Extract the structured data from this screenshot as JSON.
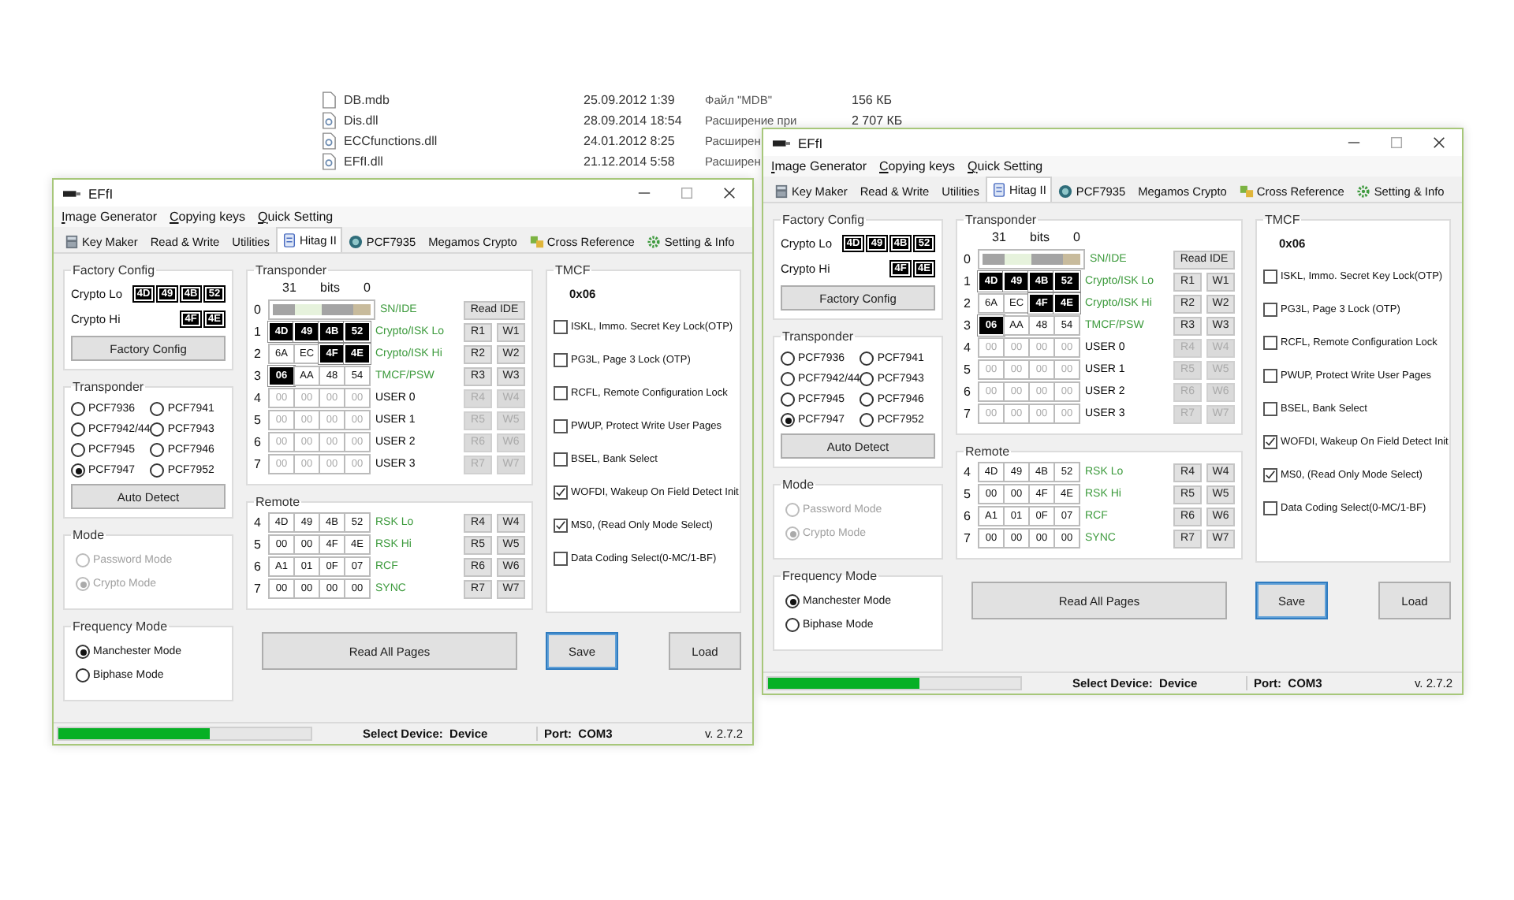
{
  "files": [
    {
      "kind": "document",
      "name": "DB.mdb",
      "date": "25.09.2012 1:39",
      "type": "Файл \"MDB\"",
      "size": "156 КБ"
    },
    {
      "kind": "library",
      "name": "Dis.dll",
      "date": "28.09.2014 18:54",
      "type": "Расширение при",
      "size": "2 707 КБ"
    },
    {
      "kind": "library",
      "name": "ECCfunctions.dll",
      "date": "24.01.2012 8:25",
      "type": "Расширен"
    },
    {
      "kind": "library",
      "name": "EFfI.dll",
      "date": "21.12.2014 5:58",
      "type": "Расширен"
    }
  ],
  "windows": [
    {
      "title": "EFfI",
      "menu": [
        "Image Generator",
        "Copying keys",
        "Quick Setting"
      ],
      "tabs": [
        {
          "label": "Key Maker",
          "kind": "calculator",
          "selected": false
        },
        {
          "label": "Read & Write",
          "kind": "text",
          "selected": false
        },
        {
          "label": "Utilities",
          "kind": "text",
          "selected": false
        },
        {
          "label": "Hitag II",
          "kind": "card",
          "selected": true
        },
        {
          "label": "PCF7935",
          "kind": "disc",
          "selected": false
        },
        {
          "label": "Megamos Crypto",
          "kind": "text",
          "selected": false
        },
        {
          "label": "Cross Reference",
          "kind": "puzzle",
          "selected": false
        },
        {
          "label": "Setting & Info",
          "kind": "gear",
          "selected": false
        }
      ],
      "factory_config": {
        "title": "Factory Config",
        "rows": [
          {
            "label": "Crypto Lo",
            "bytes": [
              "4D",
              "49",
              "4B",
              "52"
            ]
          },
          {
            "label": "Crypto Hi",
            "bytes": [
              "4F",
              "4E"
            ]
          }
        ],
        "button": "Factory Config"
      },
      "transponder_type": {
        "title": "Transponder",
        "options": [
          {
            "label": "PCF7936",
            "selected": false
          },
          {
            "label": "PCF7941",
            "selected": false
          },
          {
            "label": "PCF7942/44",
            "selected": false
          },
          {
            "label": "PCF7943",
            "selected": false
          },
          {
            "label": "PCF7945",
            "selected": false
          },
          {
            "label": "PCF7946",
            "selected": false
          },
          {
            "label": "PCF7947",
            "selected": true
          },
          {
            "label": "PCF7952",
            "selected": false
          }
        ],
        "button": "Auto Detect"
      },
      "mode": {
        "title": "Mode",
        "disabled": true,
        "options": [
          {
            "label": "Password Mode",
            "selected": false
          },
          {
            "label": "Crypto Mode",
            "selected": true
          }
        ]
      },
      "frequency_mode": {
        "title": "Frequency Mode",
        "options": [
          {
            "label": "Manchester Mode",
            "selected": true
          },
          {
            "label": "Biphase Mode",
            "selected": false
          }
        ]
      },
      "transponder": {
        "title": "Transponder",
        "bits": [
          "31",
          "bits",
          "0"
        ],
        "pages": [
          {
            "number": "0",
            "kind": "masked",
            "label": "SN/IDE",
            "color": "#3c9a3c",
            "disabled": false,
            "buttons": [
              "Read IDE"
            ]
          },
          {
            "number": "1",
            "kind": "bytes",
            "cells": [
              {
                "value": "4D",
                "inverted": true
              },
              {
                "value": "49",
                "inverted": true
              },
              {
                "value": "4B",
                "inverted": true
              },
              {
                "value": "52",
                "inverted": true
              }
            ],
            "label": "Crypto/ISK Lo",
            "color": "#3c9a3c",
            "disabled": false,
            "buttons": [
              "R1",
              "W1"
            ]
          },
          {
            "number": "2",
            "kind": "bytes",
            "cells": [
              {
                "value": "6A",
                "inverted": false
              },
              {
                "value": "EC",
                "inverted": false
              },
              {
                "value": "4F",
                "inverted": true
              },
              {
                "value": "4E",
                "inverted": true
              }
            ],
            "label": "Crypto/ISK Hi",
            "color": "#3c9a3c",
            "disabled": false,
            "buttons": [
              "R2",
              "W2"
            ]
          },
          {
            "number": "3",
            "kind": "bytes",
            "cells": [
              {
                "value": "06",
                "inverted": true
              },
              {
                "value": "AA",
                "inverted": false
              },
              {
                "value": "48",
                "inverted": false
              },
              {
                "value": "54",
                "inverted": false
              }
            ],
            "label": "TMCF/PSW",
            "color": "#3c9a3c",
            "disabled": false,
            "buttons": [
              "R3",
              "W3"
            ]
          },
          {
            "number": "4",
            "kind": "bytes",
            "cells": [
              {
                "value": "00",
                "inverted": false
              },
              {
                "value": "00",
                "inverted": false
              },
              {
                "value": "00",
                "inverted": false
              },
              {
                "value": "00",
                "inverted": false
              }
            ],
            "label": "USER 0",
            "color": "#000000",
            "disabled": true,
            "buttons": [
              "R4",
              "W4"
            ]
          },
          {
            "number": "5",
            "kind": "bytes",
            "cells": [
              {
                "value": "00",
                "inverted": false
              },
              {
                "value": "00",
                "inverted": false
              },
              {
                "value": "00",
                "inverted": false
              },
              {
                "value": "00",
                "inverted": false
              }
            ],
            "label": "USER 1",
            "color": "#000000",
            "disabled": true,
            "buttons": [
              "R5",
              "W5"
            ]
          },
          {
            "number": "6",
            "kind": "bytes",
            "cells": [
              {
                "value": "00",
                "inverted": false
              },
              {
                "value": "00",
                "inverted": false
              },
              {
                "value": "00",
                "inverted": false
              },
              {
                "value": "00",
                "inverted": false
              }
            ],
            "label": "USER 2",
            "color": "#000000",
            "disabled": true,
            "buttons": [
              "R6",
              "W6"
            ]
          },
          {
            "number": "7",
            "kind": "bytes",
            "cells": [
              {
                "value": "00",
                "inverted": false
              },
              {
                "value": "00",
                "inverted": false
              },
              {
                "value": "00",
                "inverted": false
              },
              {
                "value": "00",
                "inverted": false
              }
            ],
            "label": "USER 3",
            "color": "#000000",
            "disabled": true,
            "buttons": [
              "R7",
              "W7"
            ]
          }
        ]
      },
      "remote": {
        "title": "Remote",
        "pages": [
          {
            "number": "4",
            "kind": "bytes",
            "cells": [
              {
                "value": "4D",
                "inverted": false
              },
              {
                "value": "49",
                "inverted": false
              },
              {
                "value": "4B",
                "inverted": false
              },
              {
                "value": "52",
                "inverted": false
              }
            ],
            "label": "RSK Lo",
            "color": "#3c9a3c",
            "disabled": false,
            "buttons": [
              "R4",
              "W4"
            ]
          },
          {
            "number": "5",
            "kind": "bytes",
            "cells": [
              {
                "value": "00",
                "inverted": false
              },
              {
                "value": "00",
                "inverted": false
              },
              {
                "value": "4F",
                "inverted": false
              },
              {
                "value": "4E",
                "inverted": false
              }
            ],
            "label": "RSK Hi",
            "color": "#3c9a3c",
            "disabled": false,
            "buttons": [
              "R5",
              "W5"
            ]
          },
          {
            "number": "6",
            "kind": "bytes",
            "cells": [
              {
                "value": "A1",
                "inverted": false
              },
              {
                "value": "01",
                "inverted": false
              },
              {
                "value": "0F",
                "inverted": false
              },
              {
                "value": "07",
                "inverted": false
              }
            ],
            "label": "RCF",
            "color": "#3c9a3c",
            "disabled": false,
            "buttons": [
              "R6",
              "W6"
            ]
          },
          {
            "number": "7",
            "kind": "bytes",
            "cells": [
              {
                "value": "00",
                "inverted": false
              },
              {
                "value": "00",
                "inverted": false
              },
              {
                "value": "00",
                "inverted": false
              },
              {
                "value": "00",
                "inverted": false
              }
            ],
            "label": "SYNC",
            "color": "#3c9a3c",
            "disabled": false,
            "buttons": [
              "R7",
              "W7"
            ]
          }
        ]
      },
      "read_all_button": "Read All Pages",
      "tmcf": {
        "title": "TMCF",
        "value": "0x06",
        "options": [
          {
            "label": "ISKL, Immo. Secret Key Lock(OTP)",
            "checked": false
          },
          {
            "label": "PG3L, Page 3 Lock (OTP)",
            "checked": false
          },
          {
            "label": "RCFL, Remote Configuration Lock",
            "checked": false
          },
          {
            "label": "PWUP, Protect Write User Pages",
            "checked": false
          },
          {
            "label": "BSEL, Bank Select",
            "checked": false
          },
          {
            "label": "WOFDI, Wakeup On Field Detect Init",
            "checked": true
          },
          {
            "label": "MS0, (Read Only Mode Select)",
            "checked": true
          },
          {
            "label": "Data Coding Select(0-MC/1-BF)",
            "checked": false
          }
        ]
      },
      "save_button": {
        "label": "Save",
        "focused": true
      },
      "load_button": {
        "label": "Load",
        "focused": false
      },
      "status_bar": {
        "level": 0.6,
        "device": "Select Device:  Device",
        "port": "Port:  COM3",
        "version": "v. 2.7.2"
      }
    },
    {
      "title": "EFfI",
      "menu": [
        "Image Generator",
        "Copying keys",
        "Quick Setting"
      ],
      "tabs": [
        {
          "label": "Key Maker",
          "kind": "calculator",
          "selected": false
        },
        {
          "label": "Read & Write",
          "kind": "text",
          "selected": false
        },
        {
          "label": "Utilities",
          "kind": "text",
          "selected": false
        },
        {
          "label": "Hitag II",
          "kind": "card",
          "selected": true
        },
        {
          "label": "PCF7935",
          "kind": "disc",
          "selected": false
        },
        {
          "label": "Megamos Crypto",
          "kind": "text",
          "selected": false
        },
        {
          "label": "Cross Reference",
          "kind": "puzzle",
          "selected": false
        },
        {
          "label": "Setting & Info",
          "kind": "gear",
          "selected": false
        }
      ],
      "factory_config": {
        "title": "Factory Config",
        "rows": [
          {
            "label": "Crypto Lo",
            "bytes": [
              "4D",
              "49",
              "4B",
              "52"
            ]
          },
          {
            "label": "Crypto Hi",
            "bytes": [
              "4F",
              "4E"
            ]
          }
        ],
        "button": "Factory Config"
      },
      "transponder_type": {
        "title": "Transponder",
        "options": [
          {
            "label": "PCF7936",
            "selected": false
          },
          {
            "label": "PCF7941",
            "selected": false
          },
          {
            "label": "PCF7942/44",
            "selected": false
          },
          {
            "label": "PCF7943",
            "selected": false
          },
          {
            "label": "PCF7945",
            "selected": false
          },
          {
            "label": "PCF7946",
            "selected": false
          },
          {
            "label": "PCF7947",
            "selected": true
          },
          {
            "label": "PCF7952",
            "selected": false
          }
        ],
        "button": "Auto Detect"
      },
      "mode": {
        "title": "Mode",
        "disabled": true,
        "options": [
          {
            "label": "Password Mode",
            "selected": false
          },
          {
            "label": "Crypto Mode",
            "selected": true
          }
        ]
      },
      "frequency_mode": {
        "title": "Frequency Mode",
        "options": [
          {
            "label": "Manchester Mode",
            "selected": true
          },
          {
            "label": "Biphase Mode",
            "selected": false
          }
        ]
      },
      "transponder": {
        "title": "Transponder",
        "bits": [
          "31",
          "bits",
          "0"
        ],
        "pages": [
          {
            "number": "0",
            "kind": "masked",
            "label": "SN/IDE",
            "color": "#3c9a3c",
            "disabled": false,
            "buttons": [
              "Read IDE"
            ]
          },
          {
            "number": "1",
            "kind": "bytes",
            "cells": [
              {
                "value": "4D",
                "inverted": true
              },
              {
                "value": "49",
                "inverted": true
              },
              {
                "value": "4B",
                "inverted": true
              },
              {
                "value": "52",
                "inverted": true
              }
            ],
            "label": "Crypto/ISK Lo",
            "color": "#3c9a3c",
            "disabled": false,
            "buttons": [
              "R1",
              "W1"
            ]
          },
          {
            "number": "2",
            "kind": "bytes",
            "cells": [
              {
                "value": "6A",
                "inverted": false
              },
              {
                "value": "EC",
                "inverted": false
              },
              {
                "value": "4F",
                "inverted": true
              },
              {
                "value": "4E",
                "inverted": true
              }
            ],
            "label": "Crypto/ISK Hi",
            "color": "#3c9a3c",
            "disabled": false,
            "buttons": [
              "R2",
              "W2"
            ]
          },
          {
            "number": "3",
            "kind": "bytes",
            "cells": [
              {
                "value": "06",
                "inverted": true
              },
              {
                "value": "AA",
                "inverted": false
              },
              {
                "value": "48",
                "inverted": false
              },
              {
                "value": "54",
                "inverted": false
              }
            ],
            "label": "TMCF/PSW",
            "color": "#3c9a3c",
            "disabled": false,
            "buttons": [
              "R3",
              "W3"
            ]
          },
          {
            "number": "4",
            "kind": "bytes",
            "cells": [
              {
                "value": "00",
                "inverted": false
              },
              {
                "value": "00",
                "inverted": false
              },
              {
                "value": "00",
                "inverted": false
              },
              {
                "value": "00",
                "inverted": false
              }
            ],
            "label": "USER 0",
            "color": "#000000",
            "disabled": true,
            "buttons": [
              "R4",
              "W4"
            ]
          },
          {
            "number": "5",
            "kind": "bytes",
            "cells": [
              {
                "value": "00",
                "inverted": false
              },
              {
                "value": "00",
                "inverted": false
              },
              {
                "value": "00",
                "inverted": false
              },
              {
                "value": "00",
                "inverted": false
              }
            ],
            "label": "USER 1",
            "color": "#000000",
            "disabled": true,
            "buttons": [
              "R5",
              "W5"
            ]
          },
          {
            "number": "6",
            "kind": "bytes",
            "cells": [
              {
                "value": "00",
                "inverted": false
              },
              {
                "value": "00",
                "inverted": false
              },
              {
                "value": "00",
                "inverted": false
              },
              {
                "value": "00",
                "inverted": false
              }
            ],
            "label": "USER 2",
            "color": "#000000",
            "disabled": true,
            "buttons": [
              "R6",
              "W6"
            ]
          },
          {
            "number": "7",
            "kind": "bytes",
            "cells": [
              {
                "value": "00",
                "inverted": false
              },
              {
                "value": "00",
                "inverted": false
              },
              {
                "value": "00",
                "inverted": false
              },
              {
                "value": "00",
                "inverted": false
              }
            ],
            "label": "USER 3",
            "color": "#000000",
            "disabled": true,
            "buttons": [
              "R7",
              "W7"
            ]
          }
        ]
      },
      "remote": {
        "title": "Remote",
        "pages": [
          {
            "number": "4",
            "kind": "bytes",
            "cells": [
              {
                "value": "4D",
                "inverted": false
              },
              {
                "value": "49",
                "inverted": false
              },
              {
                "value": "4B",
                "inverted": false
              },
              {
                "value": "52",
                "inverted": false
              }
            ],
            "label": "RSK Lo",
            "color": "#3c9a3c",
            "disabled": false,
            "buttons": [
              "R4",
              "W4"
            ]
          },
          {
            "number": "5",
            "kind": "bytes",
            "cells": [
              {
                "value": "00",
                "inverted": false
              },
              {
                "value": "00",
                "inverted": false
              },
              {
                "value": "4F",
                "inverted": false
              },
              {
                "value": "4E",
                "inverted": false
              }
            ],
            "label": "RSK Hi",
            "color": "#3c9a3c",
            "disabled": false,
            "buttons": [
              "R5",
              "W5"
            ]
          },
          {
            "number": "6",
            "kind": "bytes",
            "cells": [
              {
                "value": "A1",
                "inverted": false
              },
              {
                "value": "01",
                "inverted": false
              },
              {
                "value": "0F",
                "inverted": false
              },
              {
                "value": "07",
                "inverted": false
              }
            ],
            "label": "RCF",
            "color": "#3c9a3c",
            "disabled": false,
            "buttons": [
              "R6",
              "W6"
            ]
          },
          {
            "number": "7",
            "kind": "bytes",
            "cells": [
              {
                "value": "00",
                "inverted": false
              },
              {
                "value": "00",
                "inverted": false
              },
              {
                "value": "00",
                "inverted": false
              },
              {
                "value": "00",
                "inverted": false
              }
            ],
            "label": "SYNC",
            "color": "#3c9a3c",
            "disabled": false,
            "buttons": [
              "R7",
              "W7"
            ]
          }
        ]
      },
      "read_all_button": "Read All Pages",
      "tmcf": {
        "title": "TMCF",
        "value": "0x06",
        "options": [
          {
            "label": "ISKL, Immo. Secret Key Lock(OTP)",
            "checked": false
          },
          {
            "label": "PG3L, Page 3 Lock (OTP)",
            "checked": false
          },
          {
            "label": "RCFL, Remote Configuration Lock",
            "checked": false
          },
          {
            "label": "PWUP, Protect Write User Pages",
            "checked": false
          },
          {
            "label": "BSEL, Bank Select",
            "checked": false
          },
          {
            "label": "WOFDI, Wakeup On Field Detect Init",
            "checked": true
          },
          {
            "label": "MS0, (Read Only Mode Select)",
            "checked": true
          },
          {
            "label": "Data Coding Select(0-MC/1-BF)",
            "checked": false
          }
        ]
      },
      "save_button": {
        "label": "Save",
        "focused": true
      },
      "load_button": {
        "label": "Load",
        "focused": false
      },
      "status_bar": {
        "level": 0.6,
        "device": "Select Device:  Device",
        "port": "Port:  COM3",
        "version": "v. 2.7.2"
      }
    }
  ]
}
